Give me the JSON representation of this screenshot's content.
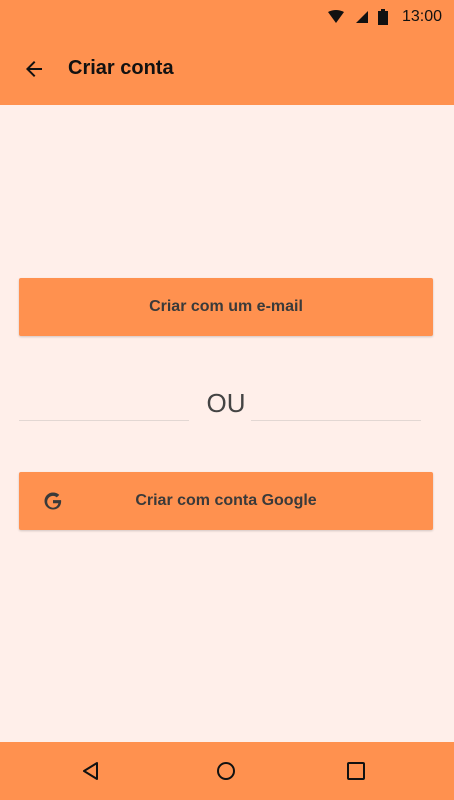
{
  "status_bar": {
    "time": "13:00"
  },
  "app_bar": {
    "title": "Criar conta"
  },
  "actions": {
    "email_button_label": "Criar com um e-mail",
    "divider_text": "OU",
    "google_button_label": "Criar com conta Google"
  },
  "colors": {
    "primary": "#FF914F",
    "background": "#FFEFEA",
    "text": "#3A3A3A"
  },
  "icons": {
    "back": "arrow-left-icon",
    "google": "google-g-icon",
    "nav": [
      "triangle-back-icon",
      "circle-home-icon",
      "square-recents-icon"
    ]
  }
}
